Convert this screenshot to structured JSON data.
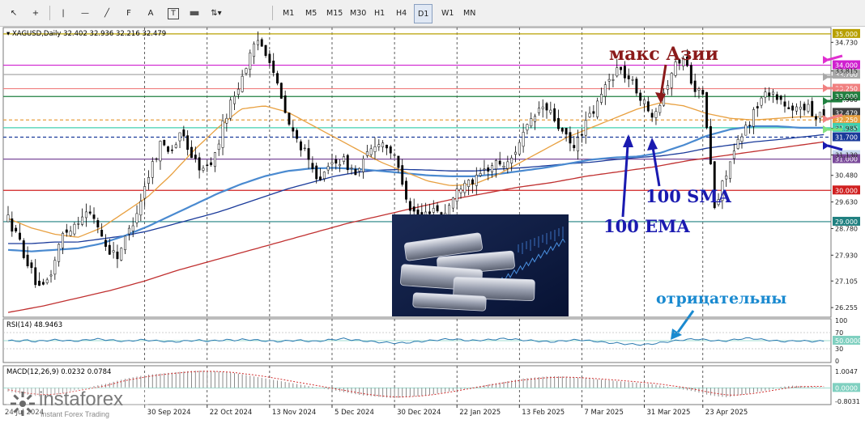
{
  "toolbar": {
    "tools": [
      "cursor-arrow",
      "crosshair",
      "vertical-line",
      "horizontal-line",
      "trendline",
      "fibonacci",
      "text-label",
      "text-box",
      "rectangle",
      "arrows-menu"
    ],
    "timeframes": [
      "M1",
      "M5",
      "M15",
      "M30",
      "H1",
      "H4",
      "D1",
      "W1",
      "MN"
    ],
    "active_timeframe": "D1"
  },
  "chart_data": [
    {
      "type": "candlestick",
      "title": "XAGUSD,Daily  32.402 32.936 32.216 32.479",
      "ylim": [
        26.0,
        35.1
      ],
      "y_ticks": [
        34.73,
        33.815,
        32.9,
        31.985,
        31.13,
        30.48,
        29.63,
        28.78,
        27.93,
        27.105,
        26.255
      ],
      "x_tick_labels": [
        "30 Sep 2024",
        "22 Oct 2024",
        "13 Nov 2024",
        "5 Dec 2024",
        "30 Dec 2024",
        "22 Jan 2025",
        "13 Feb 2025",
        "7 Mar 2025",
        "31 Mar 2025",
        "23 Apr 2025"
      ],
      "start_label": "24 Jul 2024",
      "last_price": 32.479,
      "price_path": [
        29.1,
        28.4,
        27.5,
        26.7,
        27.4,
        28.6,
        28.9,
        29.3,
        29.1,
        28.2,
        27.9,
        28.6,
        29.5,
        30.6,
        31.5,
        31.3,
        31.8,
        31.0,
        30.6,
        31.1,
        32.4,
        33.2,
        34.1,
        34.8,
        34.3,
        33.0,
        31.9,
        31.4,
        30.6,
        30.4,
        31.0,
        30.9,
        30.5,
        31.1,
        31.6,
        31.4,
        30.6,
        29.4,
        29.1,
        29.5,
        29.2,
        29.8,
        30.4,
        30.3,
        30.7,
        30.9,
        30.8,
        31.6,
        32.1,
        32.7,
        32.4,
        31.8,
        31.3,
        32.1,
        32.6,
        33.4,
        33.9,
        33.6,
        33.1,
        32.4,
        32.9,
        33.8,
        34.3,
        33.4,
        32.9,
        29.3,
        30.6,
        31.4,
        32.1,
        32.8,
        33.2,
        32.9,
        32.4,
        32.8,
        32.4,
        32.5
      ],
      "series": [
        {
          "name": "100 EMA",
          "color": "#1a3a9a",
          "path": [
            28.3,
            28.3,
            28.35,
            28.35,
            28.45,
            28.55,
            28.7,
            28.9,
            29.1,
            29.3,
            29.55,
            29.8,
            30.05,
            30.25,
            30.45,
            30.58,
            30.65,
            30.67,
            30.65,
            30.62,
            30.62,
            30.68,
            30.72,
            30.78,
            30.85,
            30.9,
            30.98,
            31.05,
            31.1,
            31.2,
            31.35,
            31.45,
            31.55,
            31.62,
            31.7,
            31.78
          ]
        },
        {
          "name": "100 SMA",
          "color": "#4a8ad0",
          "path": [
            28.1,
            28.05,
            28.1,
            28.15,
            28.3,
            28.55,
            28.85,
            29.2,
            29.55,
            29.9,
            30.2,
            30.45,
            30.62,
            30.7,
            30.72,
            30.68,
            30.62,
            30.55,
            30.48,
            30.45,
            30.45,
            30.52,
            30.62,
            30.72,
            30.85,
            30.98,
            31.05,
            31.08,
            31.2,
            31.45,
            31.75,
            31.95,
            32.05,
            32.05,
            32.0,
            32.0
          ]
        },
        {
          "color": "#e8a040",
          "path": [
            29.1,
            28.8,
            28.6,
            28.5,
            28.8,
            29.3,
            29.8,
            30.5,
            31.3,
            32.0,
            32.6,
            32.7,
            32.5,
            32.1,
            31.7,
            31.3,
            30.9,
            30.6,
            30.3,
            30.15,
            30.2,
            30.5,
            30.9,
            31.3,
            31.7,
            32.0,
            32.3,
            32.6,
            32.8,
            32.7,
            32.45,
            32.3,
            32.25,
            32.3,
            32.35,
            32.35
          ]
        },
        {
          "color": "#c03030",
          "path": [
            26.1,
            26.3,
            26.55,
            26.8,
            27.1,
            27.45,
            27.75,
            28.05,
            28.35,
            28.65,
            28.95,
            29.2,
            29.45,
            29.7,
            29.9,
            30.1,
            30.25,
            30.45,
            30.6,
            30.75,
            30.95,
            31.1,
            31.25,
            31.4,
            31.55
          ]
        }
      ],
      "levels": [
        {
          "value": 35.0,
          "label": "35.000",
          "color": "#b8a000",
          "style": "solid"
        },
        {
          "value": 34.0,
          "label": "34.000",
          "color": "#d020d0",
          "style": "solid"
        },
        {
          "value": 33.7,
          "label": "33.700",
          "color": "#a8a8a8",
          "style": "solid"
        },
        {
          "value": 33.25,
          "label": "33.250",
          "color": "#f08080",
          "style": "solid"
        },
        {
          "value": 33.0,
          "label": "33.000",
          "color": "#208040",
          "style": "solid"
        },
        {
          "value": 32.479,
          "label": "32.479",
          "color": "#404040",
          "style": "none"
        },
        {
          "value": 32.25,
          "label": "32.250",
          "color": "#e8a040",
          "style": "dashed"
        },
        {
          "value": 32.0,
          "label": "32.000",
          "color": "#40d0b0",
          "style": "solid"
        },
        {
          "value": 31.7,
          "label": "31.700",
          "color": "#1a3a9a",
          "style": "dashed"
        },
        {
          "value": 31.13,
          "label": "31.130",
          "color": "#c8d8f0",
          "style": "none"
        },
        {
          "value": 31.0,
          "label": "31.000",
          "color": "#7a4a9a",
          "style": "solid"
        },
        {
          "value": 30.0,
          "label": "30.000",
          "color": "#d02020",
          "style": "solid"
        },
        {
          "value": 29.0,
          "label": "29.000",
          "color": "#208080",
          "style": "solid"
        }
      ],
      "annotations": [
        {
          "text": "макс Азии",
          "color": "#8b1a1a"
        },
        {
          "text": "100 SMA",
          "color": "#1a1ab0"
        },
        {
          "text": "100 EMA",
          "color": "#1a1ab0"
        },
        {
          "text": "отрицательны",
          "color": "#1a8ad0"
        }
      ],
      "side_arrow_colors": [
        "#e030d0",
        "#a8a8a8",
        "#f08080",
        "#208040",
        "#f08080",
        "#80e080",
        "#1a1ab0"
      ]
    },
    {
      "type": "line",
      "title": "RSI(14) 48.9463",
      "ylim": [
        0,
        100
      ],
      "y_ticks": [
        100,
        70,
        50,
        30,
        0
      ],
      "level_label": "50.0000",
      "series": [
        {
          "color": "#2a7ab0",
          "path": [
            50,
            49,
            51,
            48,
            50,
            52,
            51,
            49,
            50,
            53,
            54,
            52,
            50,
            48,
            51,
            52,
            50,
            49,
            47,
            48,
            50,
            51,
            49,
            50,
            52,
            51,
            53,
            52,
            50,
            49,
            48,
            50,
            51,
            49,
            48,
            51,
            53,
            55,
            52,
            50,
            48,
            46,
            45,
            44,
            45,
            47,
            49,
            51,
            53,
            54,
            52,
            50,
            51,
            52,
            54,
            55,
            53,
            51,
            50,
            48,
            47,
            49,
            51,
            52,
            50,
            48,
            45,
            44,
            42,
            41,
            40,
            42,
            45,
            48,
            51,
            53,
            54,
            52,
            50,
            49,
            52,
            55,
            56,
            53,
            51,
            49,
            48,
            50,
            49,
            48,
            49
          ]
        }
      ]
    },
    {
      "type": "bar",
      "title": "MACD(12,26,9) 0.0232 0.0784",
      "ylim": [
        -0.8031,
        1.0047
      ],
      "y_ticks": [
        1.0047,
        0.0,
        -0.8031
      ],
      "level_label": "0.0000",
      "colors": {
        "bars": "#8a8a8a",
        "signal": "#d03030"
      },
      "histogram": [
        -0.2,
        -0.3,
        -0.4,
        -0.45,
        -0.4,
        -0.3,
        -0.15,
        -0.05,
        0.1,
        0.2,
        0.35,
        0.5,
        0.6,
        0.7,
        0.75,
        0.8,
        0.85,
        0.9,
        0.92,
        0.9,
        0.85,
        0.8,
        0.7,
        0.6,
        0.5,
        0.4,
        0.3,
        0.2,
        0.1,
        0.0,
        -0.1,
        -0.2,
        -0.3,
        -0.4,
        -0.45,
        -0.5,
        -0.55,
        -0.5,
        -0.45,
        -0.4,
        -0.3,
        -0.2,
        -0.1,
        0.0,
        0.1,
        0.2,
        0.3,
        0.4,
        0.5,
        0.55,
        0.6,
        0.62,
        0.6,
        0.55,
        0.5,
        0.45,
        0.4,
        0.35,
        0.3,
        0.25,
        0.2,
        0.1,
        0.0,
        -0.1,
        -0.2,
        -0.35,
        -0.45,
        -0.5,
        -0.4,
        -0.3,
        -0.2,
        -0.1,
        0.05,
        0.12,
        0.1,
        0.05,
        0.02
      ],
      "signal": [
        -0.1,
        -0.2,
        -0.3,
        -0.35,
        -0.35,
        -0.3,
        -0.2,
        -0.1,
        0.0,
        0.1,
        0.25,
        0.4,
        0.5,
        0.6,
        0.68,
        0.75,
        0.8,
        0.85,
        0.88,
        0.88,
        0.86,
        0.82,
        0.75,
        0.68,
        0.6,
        0.5,
        0.4,
        0.3,
        0.2,
        0.1,
        0.0,
        -0.1,
        -0.2,
        -0.3,
        -0.38,
        -0.44,
        -0.48,
        -0.48,
        -0.45,
        -0.4,
        -0.33,
        -0.24,
        -0.14,
        -0.04,
        0.06,
        0.16,
        0.25,
        0.34,
        0.42,
        0.48,
        0.53,
        0.56,
        0.57,
        0.55,
        0.52,
        0.48,
        0.44,
        0.4,
        0.35,
        0.3,
        0.25,
        0.18,
        0.1,
        0.02,
        -0.08,
        -0.2,
        -0.3,
        -0.38,
        -0.38,
        -0.33,
        -0.25,
        -0.16,
        -0.06,
        0.03,
        0.07,
        0.08,
        0.08
      ]
    }
  ],
  "watermark": {
    "brand": "instaforex",
    "tagline": "Instant Forex Trading"
  }
}
